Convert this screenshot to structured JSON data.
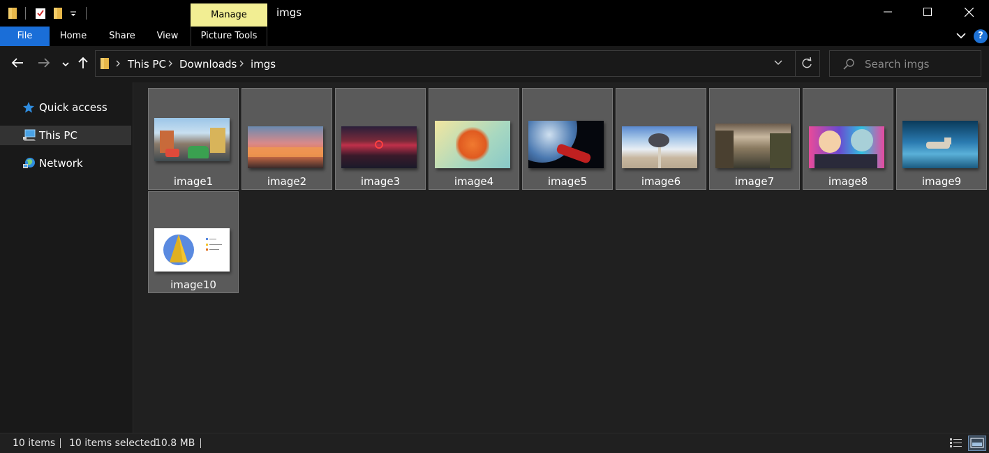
{
  "titlebar": {
    "manage_label": "Manage",
    "window_title": "imgs",
    "icons": [
      "folder-icon",
      "properties-icon",
      "new-folder-icon",
      "customize-quick-access-icon"
    ],
    "buttons": [
      "minimize-icon",
      "maximize-icon",
      "close-icon"
    ]
  },
  "ribbon": {
    "tabs": [
      "File",
      "Home",
      "Share",
      "View",
      "Picture Tools"
    ],
    "help_label": "?",
    "accent_color": "#1a6ed8",
    "manage_color": "#f2ee93"
  },
  "address": {
    "crumbs": [
      "This PC",
      "Downloads",
      "imgs"
    ],
    "search_placeholder": "Search imgs"
  },
  "sidebar": {
    "items": [
      {
        "label": "Quick access",
        "icon": "star-icon",
        "selected": false
      },
      {
        "label": "This PC",
        "icon": "computer-icon",
        "selected": true
      },
      {
        "label": "Network",
        "icon": "network-icon",
        "selected": false
      }
    ]
  },
  "files": [
    {
      "name": "image1",
      "selected": true
    },
    {
      "name": "image2",
      "selected": true
    },
    {
      "name": "image3",
      "selected": true
    },
    {
      "name": "image4",
      "selected": true
    },
    {
      "name": "image5",
      "selected": true
    },
    {
      "name": "image6",
      "selected": true
    },
    {
      "name": "image7",
      "selected": true
    },
    {
      "name": "image8",
      "selected": true
    },
    {
      "name": "image9",
      "selected": true
    },
    {
      "name": "image10",
      "selected": true
    }
  ],
  "status": {
    "item_count": "10 items",
    "selection": "10 items selected",
    "size": "10.8 MB"
  }
}
